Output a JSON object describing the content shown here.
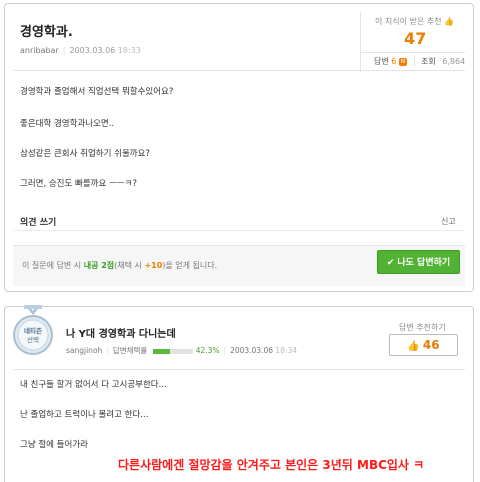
{
  "question": {
    "title": "경영학과.",
    "author": "anribabar",
    "date": "2003.03.06",
    "time": "18:33",
    "rec_label": "이 지식이 받은 추천",
    "rec_count": "47",
    "answers_label": "답변",
    "answers_count": "6",
    "answers_badge": "N",
    "views_label": "조회",
    "views_count": "6,864",
    "lines": [
      "경영학과 졸업해서 직업선택 뭐할수있어요?",
      "좋은대학 경영학과나오면..",
      "삼성같은 큰회사 취업하기 쉬울까요?",
      "그러면, 승진도 빠를까요 ㅡㅡㅋ?"
    ],
    "opinion_label": "의견 쓰기",
    "report_label": "신고",
    "notice_pre": "이 질문에 답변 시",
    "notice_points": "내공 2점",
    "notice_mid": "(채택 시",
    "notice_bonus": "+10",
    "notice_post": ")을 얻게 됩니다.",
    "answer_button": "나도 답변하기"
  },
  "answer": {
    "medal_line1": "네티즌",
    "medal_line2": "선택",
    "title": "나 Y대 경영학과 다니는데",
    "author": "sangjinoh",
    "adopt_label": "답변채택률",
    "adopt_rate": "42.3%",
    "adopt_fraction": 0.423,
    "date": "2003.03.06",
    "time": "18:34",
    "rec_label": "답변 추천하기",
    "rec_count": "46",
    "lines": [
      "내 친구들 할거 없어서 다 고시공부한다...",
      "난 졸업하고 트럭이나 몰려고 한다...",
      "그냥 절에 들어가라"
    ],
    "overlay_text": "다른사람에겐 절망감을 안겨주고 본인은 3년뒤 MBC입사 ㅋ"
  },
  "colors": {
    "accent_orange": "#f07c00",
    "button_green": "#52b234",
    "overlay_red": "#ff1a1a"
  }
}
